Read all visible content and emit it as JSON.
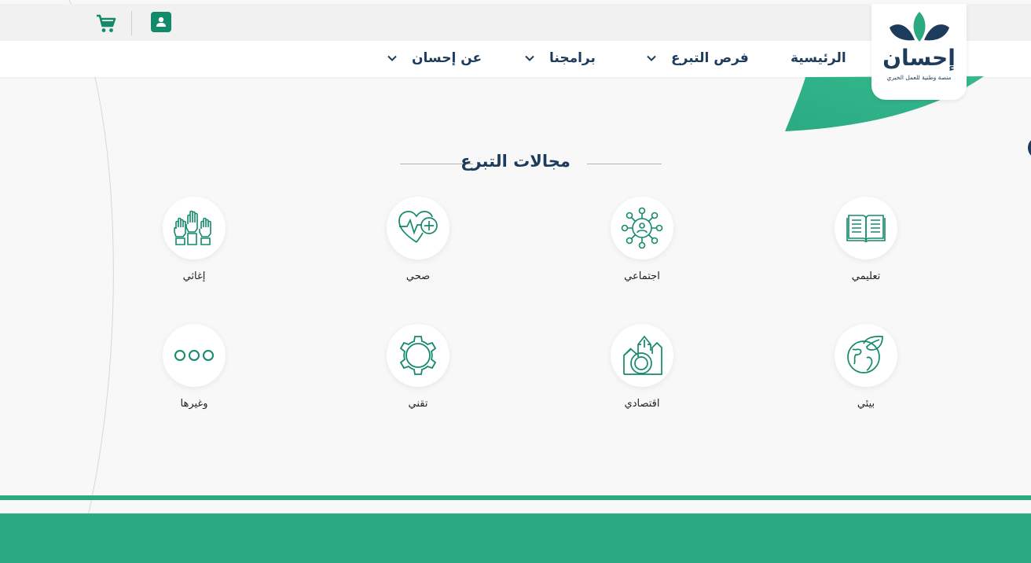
{
  "colors": {
    "brand_green": "#2baa82",
    "icon_green": "#138a6a",
    "navy": "#1d3b5a",
    "background": "#f8f8f8"
  },
  "header": {
    "cart_icon": "shopping-cart-icon",
    "account_icon": "user-account-icon"
  },
  "nav": {
    "home": "الرئيسية",
    "donation_opportunities": "فرص التبرع",
    "programs": "برامجنا",
    "about": "عن إحسان"
  },
  "logo": {
    "name": "إحسان",
    "tagline": "منصة وطنية للعمل الخيري"
  },
  "section": {
    "title": "مجالات التبرع"
  },
  "categories": [
    {
      "label": "تعليمي",
      "icon": "open-book-icon"
    },
    {
      "label": "اجتماعي",
      "icon": "community-network-icon"
    },
    {
      "label": "صحي",
      "icon": "heart-health-icon"
    },
    {
      "label": "إغاثي",
      "icon": "raised-hands-icon"
    },
    {
      "label": "بيئي",
      "icon": "globe-leaf-icon"
    },
    {
      "label": "اقتصادي",
      "icon": "economic-growth-icon"
    },
    {
      "label": "تقني",
      "icon": "gear-icon"
    },
    {
      "label": "وغيرها",
      "icon": "more-circles-icon"
    }
  ]
}
